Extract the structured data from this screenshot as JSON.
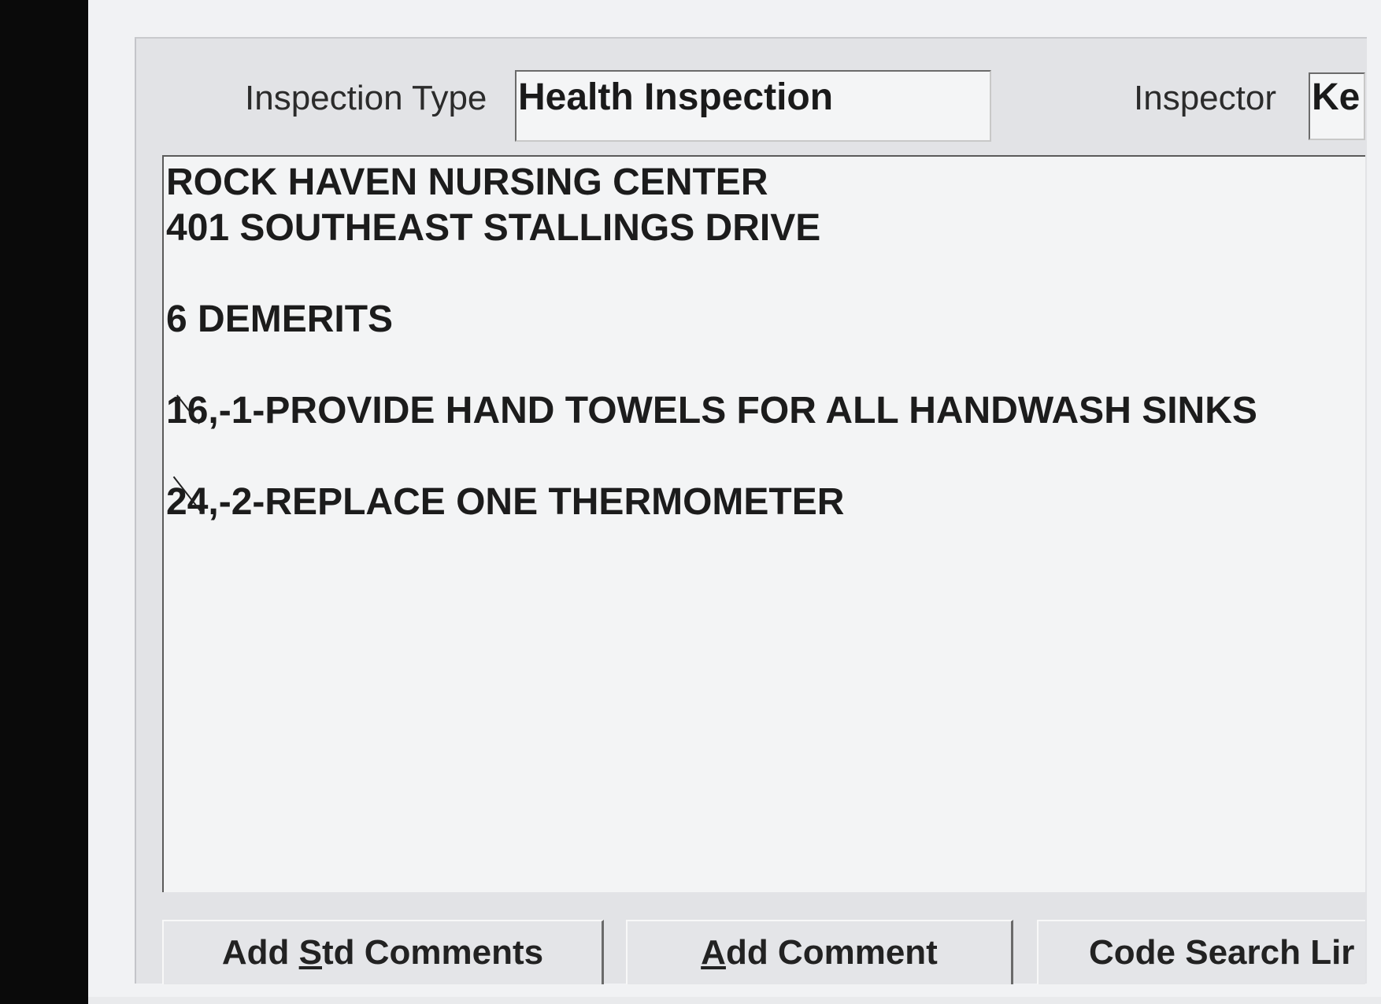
{
  "header": {
    "inspection_type_label": "Inspection Type",
    "inspection_type_value": "Health Inspection",
    "inspector_label": "Inspector",
    "inspector_value": "Ke"
  },
  "comments": {
    "lines": [
      "ROCK HAVEN NURSING CENTER",
      "401 SOUTHEAST STALLINGS DRIVE",
      "6 DEMERITS",
      "16,-1-PROVIDE HAND TOWELS FOR ALL HANDWASH SINKS",
      "24,-2-REPLACE ONE THERMOMETER"
    ]
  },
  "buttons": {
    "add_std_comments": {
      "pre": "Add ",
      "accel": "S",
      "post": "td Comments"
    },
    "add_comment": {
      "pre": "",
      "accel": "A",
      "post": "dd Comment"
    },
    "code_search": {
      "label": "Code Search Lir"
    }
  }
}
